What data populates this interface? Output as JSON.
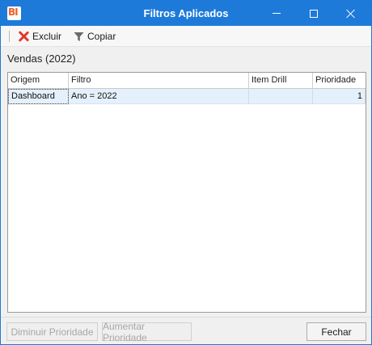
{
  "window": {
    "title": "Filtros Aplicados",
    "logo_text": "BI",
    "accent": "#1e7ad9"
  },
  "toolbar": {
    "excluir_label": "Excluir",
    "excluir_icon": "delete-x-icon",
    "copiar_label": "Copiar",
    "copiar_icon": "funnel-icon"
  },
  "group": {
    "label": "Vendas (2022)"
  },
  "grid": {
    "columns": [
      "Origem",
      "Filtro",
      "Item Drill",
      "Prioridade"
    ],
    "rows": [
      {
        "origem": "Dashboard",
        "filtro": "Ano = 2022",
        "item_drill": "",
        "prioridade": "1"
      }
    ]
  },
  "footer": {
    "diminuir_label": "Diminuir Prioridade",
    "aumentar_label": "Aumentar Prioridade",
    "fechar_label": "Fechar"
  }
}
